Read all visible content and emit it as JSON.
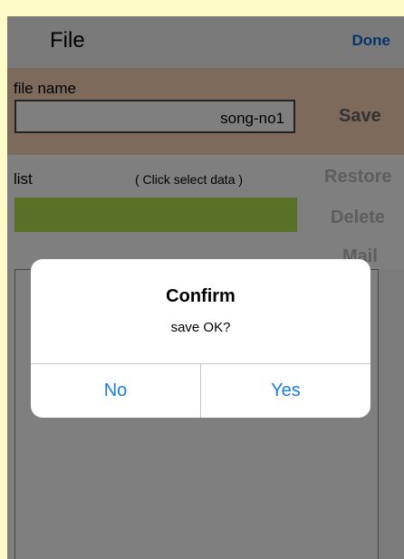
{
  "header": {
    "title": "File",
    "done_label": "Done"
  },
  "file_section": {
    "label": "file name",
    "filename_value": "song-no1",
    "save_label": "Save"
  },
  "list_section": {
    "label": "list",
    "hint": "( Click select data )",
    "restore_label": "Restore",
    "delete_label": "Delete",
    "mail_label": "Mail"
  },
  "dialog": {
    "title": "Confirm",
    "message": "save OK?",
    "no_label": "No",
    "yes_label": "Yes"
  },
  "colors": {
    "page_background": "#fdfcc9",
    "header": "#f4f4f4",
    "file_bar": "#fcd4b4",
    "selected_row": "#b3e34e",
    "accent_blue": "#1a7de6",
    "done_blue": "#0a6bd7"
  }
}
